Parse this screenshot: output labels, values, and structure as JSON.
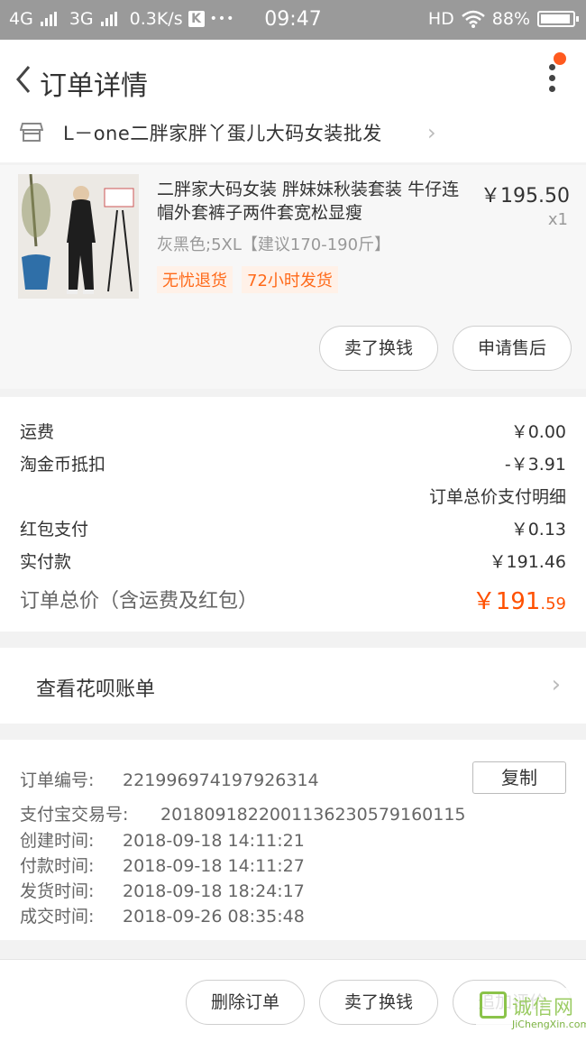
{
  "status_bar": {
    "net1": "4G",
    "net2": "3G",
    "speed": "0.3K/s",
    "k_badge": "K",
    "dots": "•••",
    "time": "09:47",
    "hd": "HD",
    "battery": "88%"
  },
  "nav": {
    "title": "订单详情"
  },
  "shop": {
    "name": "L－one二胖家胖丫蛋儿大码女装批发"
  },
  "product": {
    "title": "二胖家大码女装 胖妹妹秋装套装 牛仔连帽外套裤子两件套宽松显瘦",
    "price": "￥195.50",
    "qty": "x1",
    "sku": "灰黑色;5XL【建议170-190斤】",
    "tags": [
      "无忧退货",
      "72小时发货"
    ],
    "btn_sell": "卖了换钱",
    "btn_aftersale": "申请售后"
  },
  "summary": {
    "shipping_label": "运费",
    "shipping_value": "￥0.00",
    "coin_label": "淘金币抵扣",
    "coin_value": "-￥3.91",
    "detail_link": "订单总价支付明细",
    "redpacket_label": "红包支付",
    "redpacket_value": "￥0.13",
    "paid_label": "实付款",
    "paid_value": "￥191.46",
    "total_label": "订单总价（含运费及红包）",
    "total_int": "￥191",
    "total_dec": ".59"
  },
  "huabei": {
    "label": "查看花呗账单"
  },
  "order_info": {
    "order_no_label": "订单编号:",
    "order_no": "221996974197926314",
    "copy_btn": "复制",
    "alipay_label": "支付宝交易号:",
    "alipay_no": "2018091822001136230579160115",
    "created_label": "创建时间:",
    "created": "2018-09-18 14:11:21",
    "paid_label": "付款时间:",
    "paid": "2018-09-18 14:11:27",
    "shipped_label": "发货时间:",
    "shipped": "2018-09-18 18:24:17",
    "closed_label": "成交时间:",
    "closed": "2018-09-26 08:35:48"
  },
  "bottom_bar": {
    "delete": "删除订单",
    "sell": "卖了换钱",
    "review": "追加评价"
  },
  "watermark": {
    "cn": "诚信网",
    "en": "JiChengXin.com"
  },
  "colors": {
    "accent": "#ff5000",
    "tag_text": "#ff6a1a",
    "tag_bg": "#fff1e8",
    "status_bar": "#9a9a9a"
  }
}
